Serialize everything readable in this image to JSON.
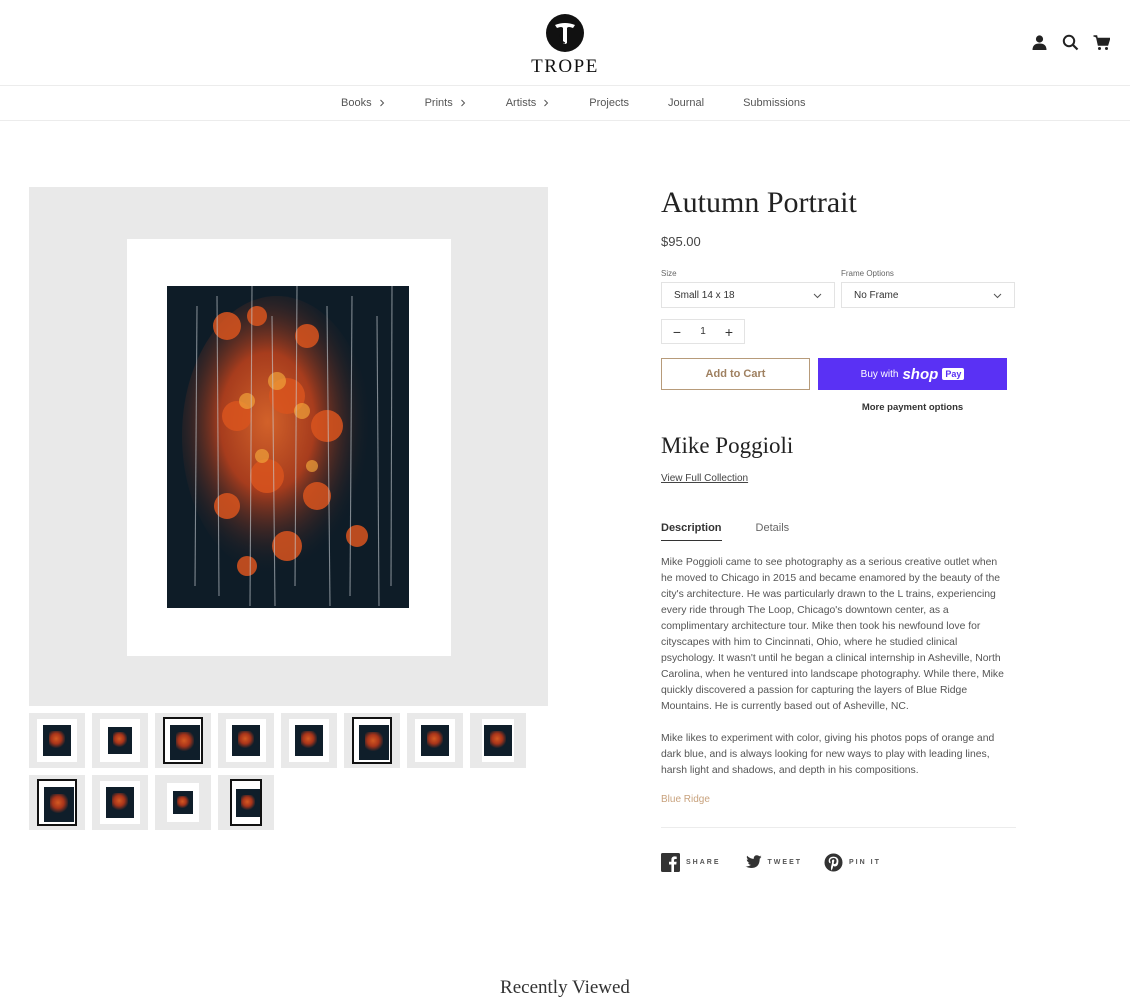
{
  "header": {
    "logo_text": "TROPE",
    "icons": [
      "account-icon",
      "search-icon",
      "cart-icon"
    ]
  },
  "nav": {
    "items": [
      {
        "label": "Books",
        "has_submenu": true
      },
      {
        "label": "Prints",
        "has_submenu": true
      },
      {
        "label": "Artists",
        "has_submenu": true
      },
      {
        "label": "Projects",
        "has_submenu": false
      },
      {
        "label": "Journal",
        "has_submenu": false
      },
      {
        "label": "Submissions",
        "has_submenu": false
      }
    ]
  },
  "gallery": {
    "thumbnail_count": 12
  },
  "product": {
    "title": "Autumn Portrait",
    "price": "$95.00",
    "size_label": "Size",
    "size_value": "Small 14 x 18",
    "frame_label": "Frame Options",
    "frame_value": "No Frame",
    "quantity": "1",
    "add_to_cart": "Add to Cart",
    "buy_with": "Buy with",
    "shop_pay_brand": "shop",
    "shop_pay_suffix": "Pay",
    "more_payment": "More payment options",
    "artist": "Mike Poggioli",
    "view_collection": "View Full Collection",
    "tabs": [
      "Description",
      "Details"
    ],
    "description": [
      "Mike Poggioli came to see photography as a serious creative outlet when he moved to Chicago in 2015 and became enamored by the beauty of the city's architecture. He was particularly drawn to the L trains, experiencing every ride through The Loop, Chicago's downtown center, as a complimentary architecture tour. Mike then took his newfound love for cityscapes with him to Cincinnati, Ohio, where he studied clinical psychology. It wasn't until he began a clinical internship in Asheville, North Carolina, when he ventured into landscape photography. While there, Mike quickly discovered a passion for capturing the layers of Blue Ridge Mountains. He is currently based out of Asheville, NC.",
      "Mike likes to experiment with color, giving his photos pops of orange and dark blue, and is always looking for new ways to play with leading lines, harsh light and shadows, and depth in his compositions."
    ],
    "tag": "Blue Ridge",
    "share": [
      "SHARE",
      "TWEET",
      "PIN IT"
    ]
  },
  "recently_viewed": "Recently Viewed",
  "colors": {
    "shop_pay": "#5a31f4",
    "add_to_cart_border": "#b79b7a",
    "tag": "#c8a27d"
  }
}
